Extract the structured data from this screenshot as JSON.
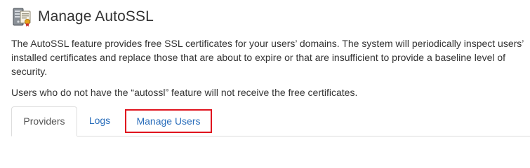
{
  "header": {
    "title": "Manage AutoSSL",
    "icon": "autossl-certificate-icon"
  },
  "description": "The AutoSSL feature provides free SSL certificates for your users’ domains. The system will periodically inspect users’ installed certificates and replace those that are about to expire or that are insufficient to provide a baseline level of security.",
  "note": "Users who do not have the “autossl” feature will not receive the free certificates.",
  "tabs": [
    {
      "label": "Providers",
      "active": true
    },
    {
      "label": "Logs",
      "active": false
    },
    {
      "label": "Manage Users",
      "active": false,
      "highlighted": true
    }
  ],
  "colors": {
    "link": "#2a6ebb",
    "highlight_border": "#e0141e",
    "text": "#333333"
  }
}
